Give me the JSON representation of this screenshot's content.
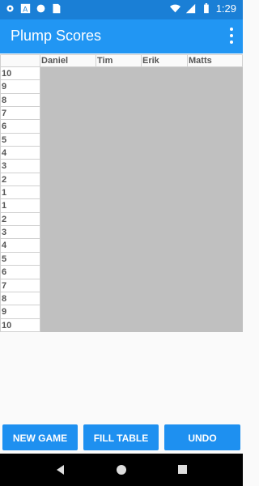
{
  "status_bar": {
    "time": "1:29",
    "icons": [
      "gear-icon",
      "a-icon",
      "circle-icon",
      "sd-icon",
      "wifi-icon",
      "signal-icon",
      "battery-icon"
    ]
  },
  "app": {
    "title": "Plump Scores",
    "menu_icon": "more-vert-icon",
    "accent_color": "#2196f3"
  },
  "table": {
    "players": [
      "Daniel",
      "Tim",
      "Erik",
      "Matts"
    ],
    "rounds": [
      "10",
      "9",
      "8",
      "7",
      "6",
      "5",
      "4",
      "3",
      "2",
      "1",
      "1",
      "2",
      "3",
      "4",
      "5",
      "6",
      "7",
      "8",
      "9",
      "10"
    ]
  },
  "buttons": {
    "new_game": "NEW GAME",
    "fill_table": "FILL TABLE",
    "undo": "UNDO"
  },
  "nav": {
    "icons": [
      "back-icon",
      "home-icon",
      "recents-icon"
    ]
  }
}
